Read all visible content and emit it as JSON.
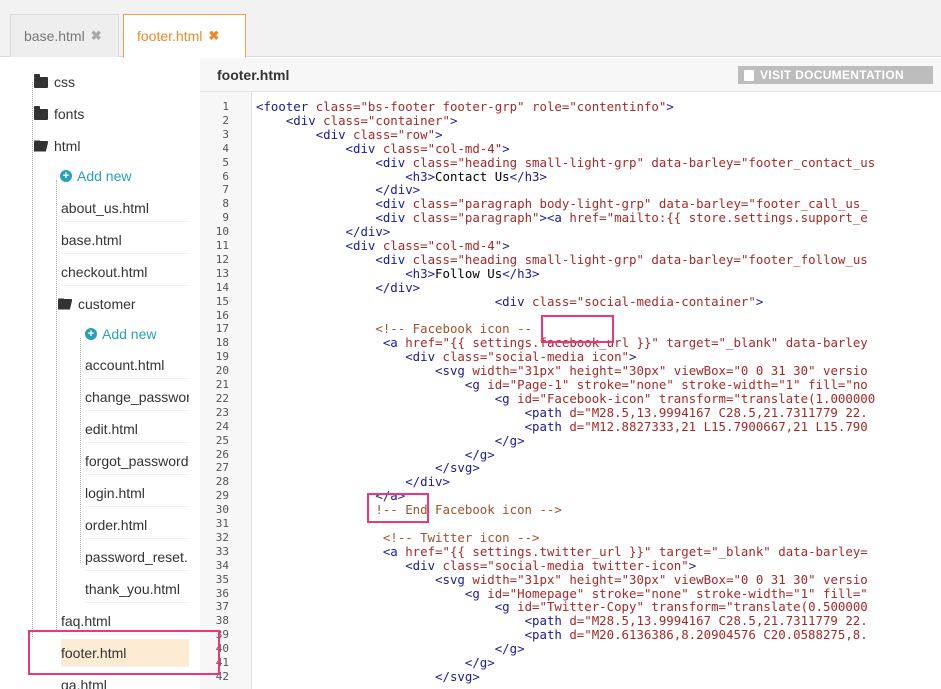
{
  "tabs": [
    {
      "label": "base.html",
      "close": "✖"
    },
    {
      "label": "footer.html",
      "close": "✖"
    }
  ],
  "sidebar": {
    "items": [
      {
        "type": "folder",
        "label": "css"
      },
      {
        "type": "folder",
        "label": "fonts"
      },
      {
        "type": "folder-open",
        "label": "html"
      },
      {
        "type": "add",
        "label": "Add new"
      },
      {
        "type": "file",
        "label": "about_us.html"
      },
      {
        "type": "file",
        "label": "base.html"
      },
      {
        "type": "file",
        "label": "checkout.html"
      },
      {
        "type": "folder-open",
        "label": "customer"
      },
      {
        "type": "add",
        "label": "Add new"
      },
      {
        "type": "file",
        "label": "account.html"
      },
      {
        "type": "file",
        "label": "change_password"
      },
      {
        "type": "file",
        "label": "edit.html"
      },
      {
        "type": "file",
        "label": "forgot_password"
      },
      {
        "type": "file",
        "label": "login.html"
      },
      {
        "type": "file",
        "label": "order.html"
      },
      {
        "type": "file",
        "label": "password_reset."
      },
      {
        "type": "file",
        "label": "thank_you.html"
      },
      {
        "type": "file",
        "label": "faq.html"
      },
      {
        "type": "file",
        "label": "footer.html",
        "active": true
      },
      {
        "type": "file",
        "label": "ga.html"
      }
    ]
  },
  "editor": {
    "title": "footer.html",
    "doc_button": "VISIT DOCUMENTATION",
    "lines": [
      [
        [
          "tag",
          "<footer "
        ],
        [
          "attr",
          "class="
        ],
        [
          "str",
          "\"bs-footer footer-grp\" "
        ],
        [
          "attr",
          "role="
        ],
        [
          "str",
          "\"contentinfo\""
        ],
        [
          "tag",
          ">"
        ]
      ],
      [
        [
          "txt",
          "    "
        ],
        [
          "tag",
          "<div "
        ],
        [
          "attr",
          "class="
        ],
        [
          "str",
          "\"container\""
        ],
        [
          "tag",
          ">"
        ]
      ],
      [
        [
          "txt",
          "        "
        ],
        [
          "tag",
          "<div "
        ],
        [
          "attr",
          "class="
        ],
        [
          "str",
          "\"row\""
        ],
        [
          "tag",
          ">"
        ]
      ],
      [
        [
          "txt",
          "            "
        ],
        [
          "tag",
          "<div "
        ],
        [
          "attr",
          "class="
        ],
        [
          "str",
          "\"col-md-4\""
        ],
        [
          "tag",
          ">"
        ]
      ],
      [
        [
          "txt",
          "                "
        ],
        [
          "tag",
          "<div "
        ],
        [
          "attr",
          "class="
        ],
        [
          "str",
          "\"heading small-light-grp\" "
        ],
        [
          "attr",
          "data-barley="
        ],
        [
          "str",
          "\"footer_contact_us"
        ]
      ],
      [
        [
          "txt",
          "                    "
        ],
        [
          "tag",
          "<h3>"
        ],
        [
          "txt",
          "Contact Us"
        ],
        [
          "tag",
          "</h3>"
        ]
      ],
      [
        [
          "txt",
          "                "
        ],
        [
          "tag",
          "</div>"
        ]
      ],
      [
        [
          "txt",
          "                "
        ],
        [
          "tag",
          "<div "
        ],
        [
          "attr",
          "class="
        ],
        [
          "str",
          "\"paragraph body-light-grp\" "
        ],
        [
          "attr",
          "data-barley="
        ],
        [
          "str",
          "\"footer_call_us_"
        ]
      ],
      [
        [
          "txt",
          "                "
        ],
        [
          "tag",
          "<div "
        ],
        [
          "attr",
          "class="
        ],
        [
          "str",
          "\"paragraph\""
        ],
        [
          "tag",
          "><a "
        ],
        [
          "attr",
          "href="
        ],
        [
          "str",
          "\"mailto:{{ store.settings.support_e"
        ]
      ],
      [
        [
          "txt",
          "            "
        ],
        [
          "tag",
          "</div>"
        ]
      ],
      [
        [
          "txt",
          "            "
        ],
        [
          "tag",
          "<div "
        ],
        [
          "attr",
          "class="
        ],
        [
          "str",
          "\"col-md-4\""
        ],
        [
          "tag",
          ">"
        ]
      ],
      [
        [
          "txt",
          "                "
        ],
        [
          "tag",
          "<div "
        ],
        [
          "attr",
          "class="
        ],
        [
          "str",
          "\"heading small-light-grp\" "
        ],
        [
          "attr",
          "data-barley="
        ],
        [
          "str",
          "\"footer_follow_us"
        ]
      ],
      [
        [
          "txt",
          "                    "
        ],
        [
          "tag",
          "<h3>"
        ],
        [
          "txt",
          "Follow Us"
        ],
        [
          "tag",
          "</h3>"
        ]
      ],
      [
        [
          "txt",
          "                "
        ],
        [
          "tag",
          "</div>"
        ]
      ],
      [
        [
          "txt",
          "                                "
        ],
        [
          "tag",
          "<div "
        ],
        [
          "attr",
          "class="
        ],
        [
          "str",
          "\"social-media-container\""
        ],
        [
          "tag",
          ">"
        ]
      ],
      [
        [
          "txt",
          ""
        ]
      ],
      [
        [
          "txt",
          "                "
        ],
        [
          "com",
          "<!-- Facebook icon --"
        ]
      ],
      [
        [
          "txt",
          "                 "
        ],
        [
          "tag",
          "<a "
        ],
        [
          "attr",
          "href="
        ],
        [
          "str",
          "\"{{ settings.facebook_url }}\" "
        ],
        [
          "attr",
          "target="
        ],
        [
          "str",
          "\"_blank\" "
        ],
        [
          "attr",
          "data-barley"
        ]
      ],
      [
        [
          "txt",
          "                    "
        ],
        [
          "tag",
          "<div "
        ],
        [
          "attr",
          "class="
        ],
        [
          "str",
          "\"social-media icon\""
        ],
        [
          "tag",
          ">"
        ]
      ],
      [
        [
          "txt",
          "                        "
        ],
        [
          "tag",
          "<svg "
        ],
        [
          "attr",
          "width="
        ],
        [
          "str",
          "\"31px\" "
        ],
        [
          "attr",
          "height="
        ],
        [
          "str",
          "\"30px\" "
        ],
        [
          "attr",
          "viewBox="
        ],
        [
          "str",
          "\"0 0 31 30\" "
        ],
        [
          "attr",
          "versio"
        ]
      ],
      [
        [
          "txt",
          "                            "
        ],
        [
          "tag",
          "<g "
        ],
        [
          "attr",
          "id="
        ],
        [
          "str",
          "\"Page-1\" "
        ],
        [
          "attr",
          "stroke="
        ],
        [
          "str",
          "\"none\" "
        ],
        [
          "attr",
          "stroke-width="
        ],
        [
          "str",
          "\"1\" "
        ],
        [
          "attr",
          "fill="
        ],
        [
          "str",
          "\"no"
        ]
      ],
      [
        [
          "txt",
          "                                "
        ],
        [
          "tag",
          "<g "
        ],
        [
          "attr",
          "id="
        ],
        [
          "str",
          "\"Facebook-icon\" "
        ],
        [
          "attr",
          "transform="
        ],
        [
          "str",
          "\"translate(1.000000"
        ]
      ],
      [
        [
          "txt",
          "                                    "
        ],
        [
          "tag",
          "<path "
        ],
        [
          "attr",
          "d="
        ],
        [
          "str",
          "\"M28.5,13.9994167 C28.5,21.7311779 22."
        ]
      ],
      [
        [
          "txt",
          "                                    "
        ],
        [
          "tag",
          "<path "
        ],
        [
          "attr",
          "d="
        ],
        [
          "str",
          "\"M12.8827333,21 L15.7900667,21 L15.790"
        ]
      ],
      [
        [
          "txt",
          "                                "
        ],
        [
          "tag",
          "</g>"
        ]
      ],
      [
        [
          "txt",
          "                            "
        ],
        [
          "tag",
          "</g>"
        ]
      ],
      [
        [
          "txt",
          "                        "
        ],
        [
          "tag",
          "</svg>"
        ]
      ],
      [
        [
          "txt",
          "                    "
        ],
        [
          "tag",
          "</div>"
        ]
      ],
      [
        [
          "txt",
          "                "
        ],
        [
          "tag",
          "</a>"
        ]
      ],
      [
        [
          "txt",
          "                "
        ],
        [
          "com",
          "!-- End Facebook icon -->"
        ]
      ],
      [
        [
          "txt",
          ""
        ]
      ],
      [
        [
          "txt",
          "                 "
        ],
        [
          "com",
          "<!-- Twitter icon -->"
        ]
      ],
      [
        [
          "txt",
          "                 "
        ],
        [
          "tag",
          "<a "
        ],
        [
          "attr",
          "href="
        ],
        [
          "str",
          "\"{{ settings.twitter_url }}\" "
        ],
        [
          "attr",
          "target="
        ],
        [
          "str",
          "\"_blank\" "
        ],
        [
          "attr",
          "data-barley="
        ]
      ],
      [
        [
          "txt",
          "                    "
        ],
        [
          "tag",
          "<div "
        ],
        [
          "attr",
          "class="
        ],
        [
          "str",
          "\"social-media twitter-icon\""
        ],
        [
          "tag",
          ">"
        ]
      ],
      [
        [
          "txt",
          "                        "
        ],
        [
          "tag",
          "<svg "
        ],
        [
          "attr",
          "width="
        ],
        [
          "str",
          "\"31px\" "
        ],
        [
          "attr",
          "height="
        ],
        [
          "str",
          "\"30px\" "
        ],
        [
          "attr",
          "viewBox="
        ],
        [
          "str",
          "\"0 0 31 30\" "
        ],
        [
          "attr",
          "versio"
        ]
      ],
      [
        [
          "txt",
          "                            "
        ],
        [
          "tag",
          "<g "
        ],
        [
          "attr",
          "id="
        ],
        [
          "str",
          "\"Homepage\" "
        ],
        [
          "attr",
          "stroke="
        ],
        [
          "str",
          "\"none\" "
        ],
        [
          "attr",
          "stroke-width="
        ],
        [
          "str",
          "\"1\" "
        ],
        [
          "attr",
          "fill="
        ],
        [
          "str",
          "\""
        ]
      ],
      [
        [
          "txt",
          "                                "
        ],
        [
          "tag",
          "<g "
        ],
        [
          "attr",
          "id="
        ],
        [
          "str",
          "\"Twitter-Copy\" "
        ],
        [
          "attr",
          "transform="
        ],
        [
          "str",
          "\"translate(0.500000"
        ]
      ],
      [
        [
          "txt",
          "                                    "
        ],
        [
          "tag",
          "<path "
        ],
        [
          "attr",
          "d="
        ],
        [
          "str",
          "\"M28.5,13.9994167 C28.5,21.7311779 22."
        ]
      ],
      [
        [
          "txt",
          "                                    "
        ],
        [
          "tag",
          "<path "
        ],
        [
          "attr",
          "d="
        ],
        [
          "str",
          "\"M20.6136386,8.20904576 C20.0588275,8."
        ]
      ],
      [
        [
          "txt",
          "                                "
        ],
        [
          "tag",
          "</g>"
        ]
      ],
      [
        [
          "txt",
          "                            "
        ],
        [
          "tag",
          "</g>"
        ]
      ],
      [
        [
          "txt",
          "                        "
        ],
        [
          "tag",
          "</svg>"
        ]
      ]
    ]
  }
}
